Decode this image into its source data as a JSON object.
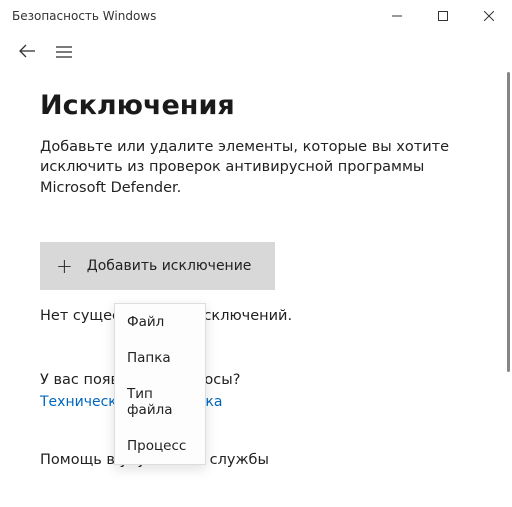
{
  "window": {
    "title": "Безопасность Windows"
  },
  "page": {
    "heading": "Исключения",
    "description": "Добавьте или удалите элементы, которые вы хотите исключить из проверок антивирусной программы Microsoft Defender.",
    "add_button": "Добавить исключение",
    "status": "Нет существующих исключений.",
    "question": "У вас появились вопросы?",
    "link": "Техническая поддержка",
    "footer": "Помощь в улучшении службы"
  },
  "dropdown": {
    "items": [
      "Файл",
      "Папка",
      "Тип файла",
      "Процесс"
    ]
  }
}
